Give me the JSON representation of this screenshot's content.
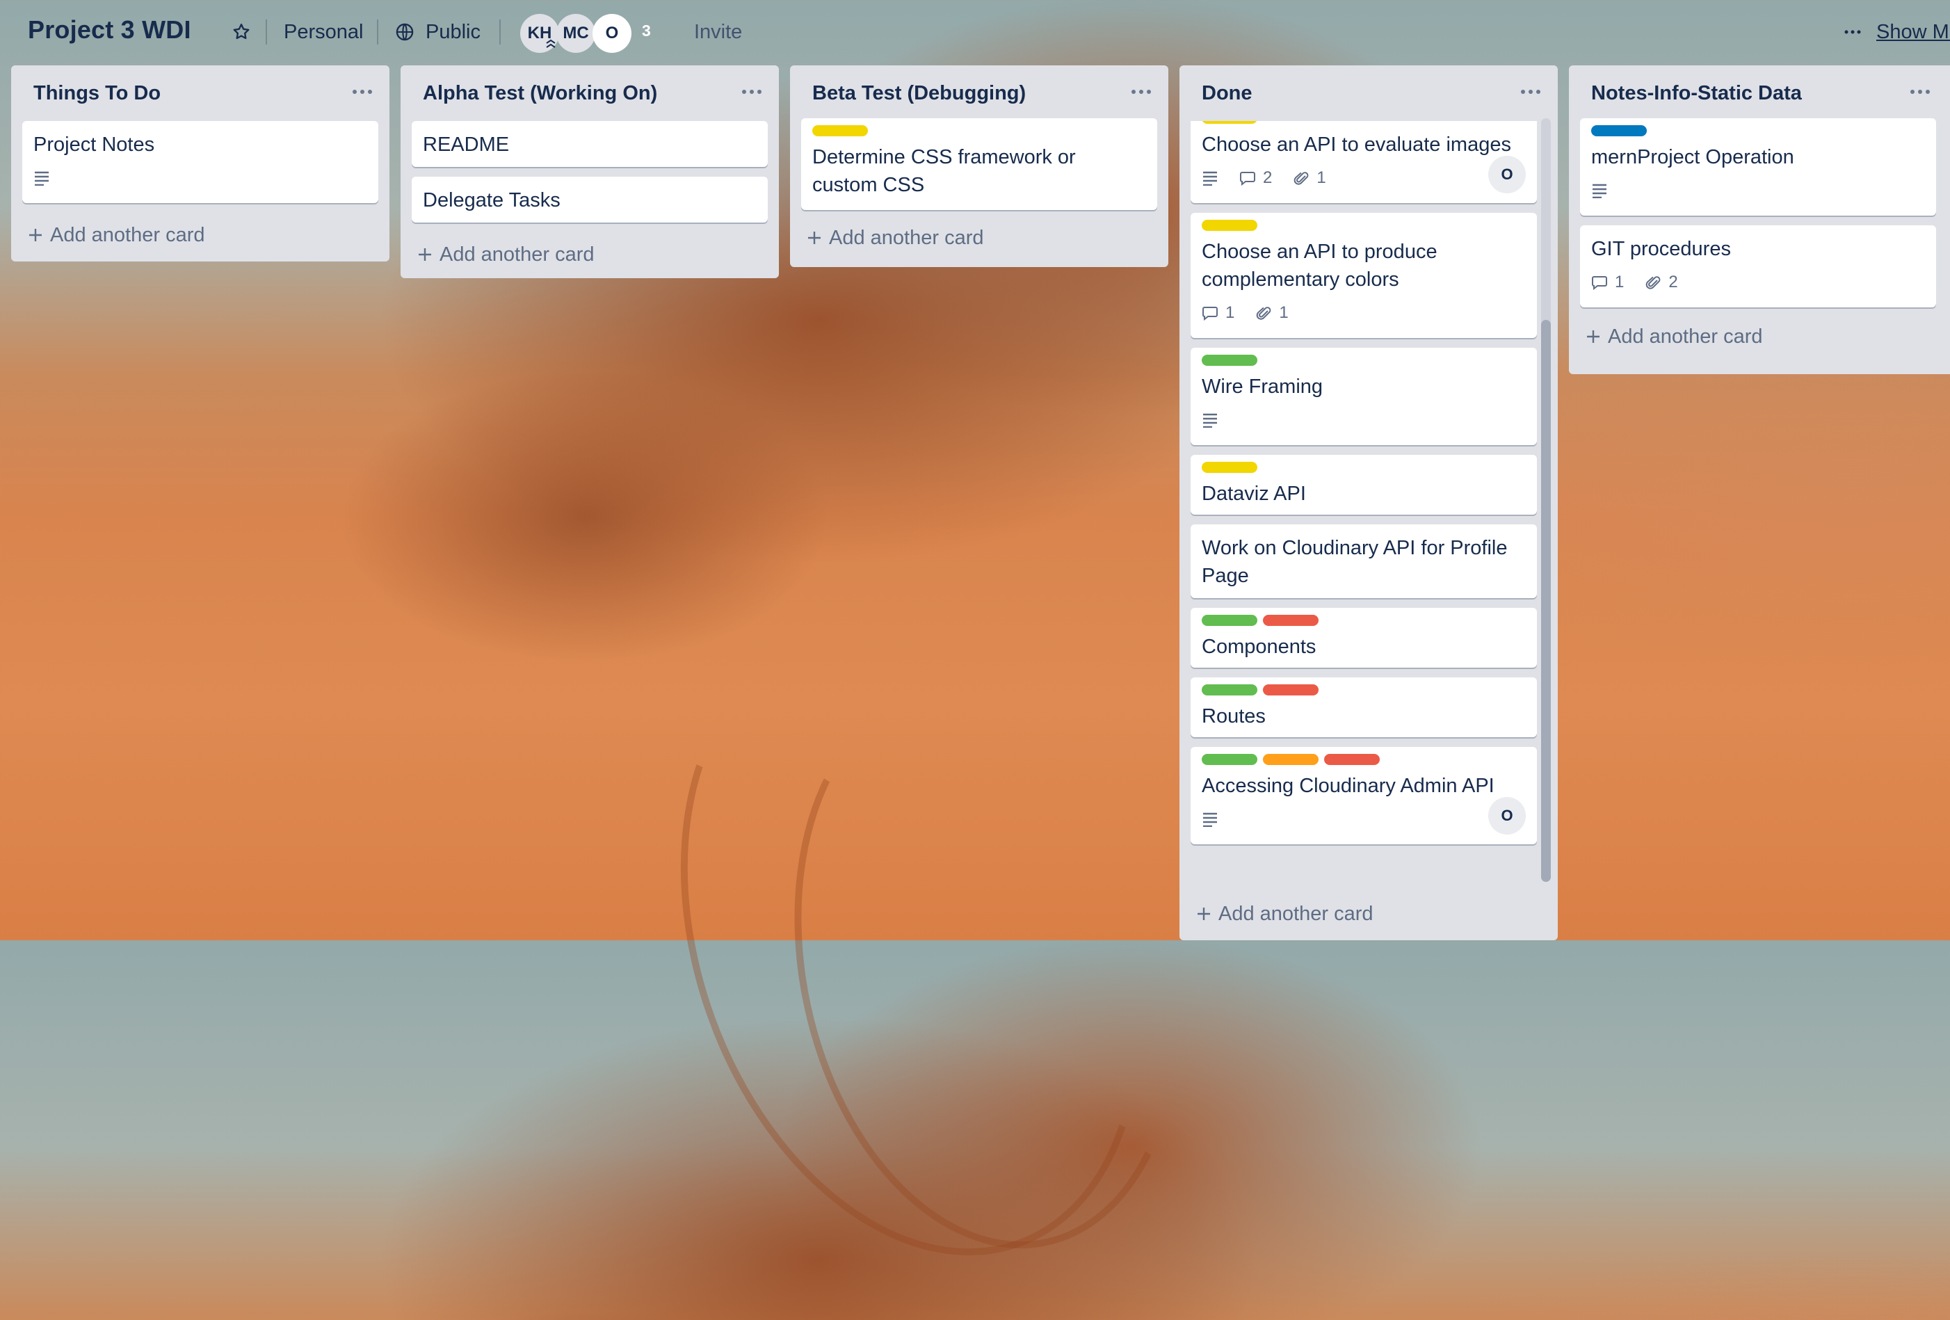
{
  "header": {
    "title": "Project 3 WDI",
    "visibility_personal": "Personal",
    "visibility_public": "Public",
    "members": [
      "KH",
      "MC",
      "O"
    ],
    "member_count": "3",
    "invite_label": "Invite",
    "show_menu_label": "Show Menu",
    "more_icon": "ellipsis-icon"
  },
  "colors": {
    "label_green": "#61bd4f",
    "label_yellow": "#f2d600",
    "label_red": "#eb5a46",
    "label_orange": "#ff9f1a",
    "label_blue": "#0079bf",
    "list_bg": "#dfe1e6"
  },
  "lists": [
    {
      "title": "Things To Do",
      "cards": [
        {
          "title": "Project Notes",
          "has_description": true
        }
      ],
      "add_card_label": "Add another card"
    },
    {
      "title": "Alpha Test (Working On)",
      "cards": [
        {
          "title": "README"
        },
        {
          "title": "Delegate Tasks"
        }
      ],
      "add_card_label": "Add another card"
    },
    {
      "title": "Beta Test (Debugging)",
      "cards": [
        {
          "title": "Determine CSS framework or custom CSS",
          "labels": [
            "yellow"
          ]
        }
      ],
      "add_card_label": "Add another card"
    },
    {
      "title": "Done",
      "cards": [
        {
          "title": "Choose an API to evaluate images",
          "labels": [
            "yellow"
          ],
          "has_description": true,
          "comments": "2",
          "attachments": "1",
          "member": "O"
        },
        {
          "title": "Choose an API to produce complementary colors",
          "labels": [
            "yellow"
          ],
          "comments": "1",
          "attachments": "1"
        },
        {
          "title": "Wire Framing",
          "labels": [
            "green"
          ],
          "has_description": true
        },
        {
          "title": "Dataviz API",
          "labels": [
            "yellow"
          ]
        },
        {
          "title": "Work on Cloudinary API for Profile Page"
        },
        {
          "title": "Components",
          "labels": [
            "green",
            "red"
          ]
        },
        {
          "title": "Routes",
          "labels": [
            "green",
            "red"
          ]
        },
        {
          "title": "Accessing Cloudinary Admin API",
          "labels": [
            "green",
            "orange",
            "red"
          ],
          "has_description": true,
          "member": "O"
        }
      ],
      "add_card_label": "Add another card"
    },
    {
      "title": "Notes-Info-Static Data",
      "cards": [
        {
          "title": "mernProject Operation",
          "labels": [
            "blue"
          ],
          "has_description": true
        },
        {
          "title": "GIT procedures",
          "comments": "1",
          "attachments": "2"
        }
      ],
      "add_card_label": "Add another card"
    }
  ]
}
